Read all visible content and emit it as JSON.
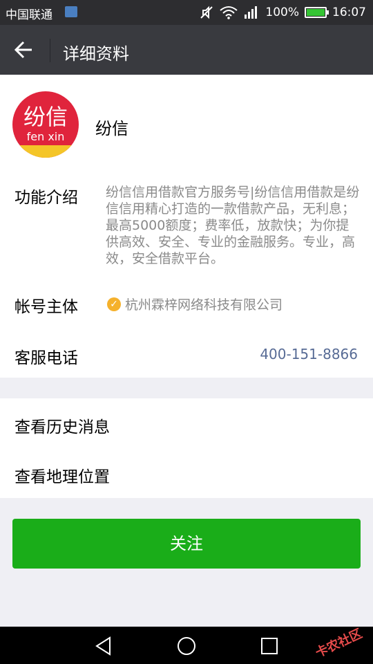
{
  "status_bar": {
    "carrier": "中国联通",
    "battery": "100%",
    "time": "16:07"
  },
  "header": {
    "title": "详细资料"
  },
  "profile": {
    "avatar_line1": "纷信",
    "avatar_line2": "fen xin",
    "name": "纷信"
  },
  "info": {
    "intro_label": "功能介绍",
    "intro_text": "纷信信用借款官方服务号|纷信信用借款是纷信信用精心打造的一款借款产品，无利息；最高5000额度；费率低，放款快；为你提供高效、安全、专业的金融服务。专业，高效，安全借款平台。",
    "account_label": "帐号主体",
    "account_value": "杭州霖梓网络科技有限公司",
    "phone_label": "客服电话",
    "phone_value": "400-151-8866"
  },
  "actions": {
    "history": "查看历史消息",
    "location": "查看地理位置"
  },
  "follow_button": "关注",
  "watermark": "卡农社区",
  "colors": {
    "brand_green": "#1aad19",
    "header_bg": "#393a3f",
    "link_blue": "#576b95"
  }
}
